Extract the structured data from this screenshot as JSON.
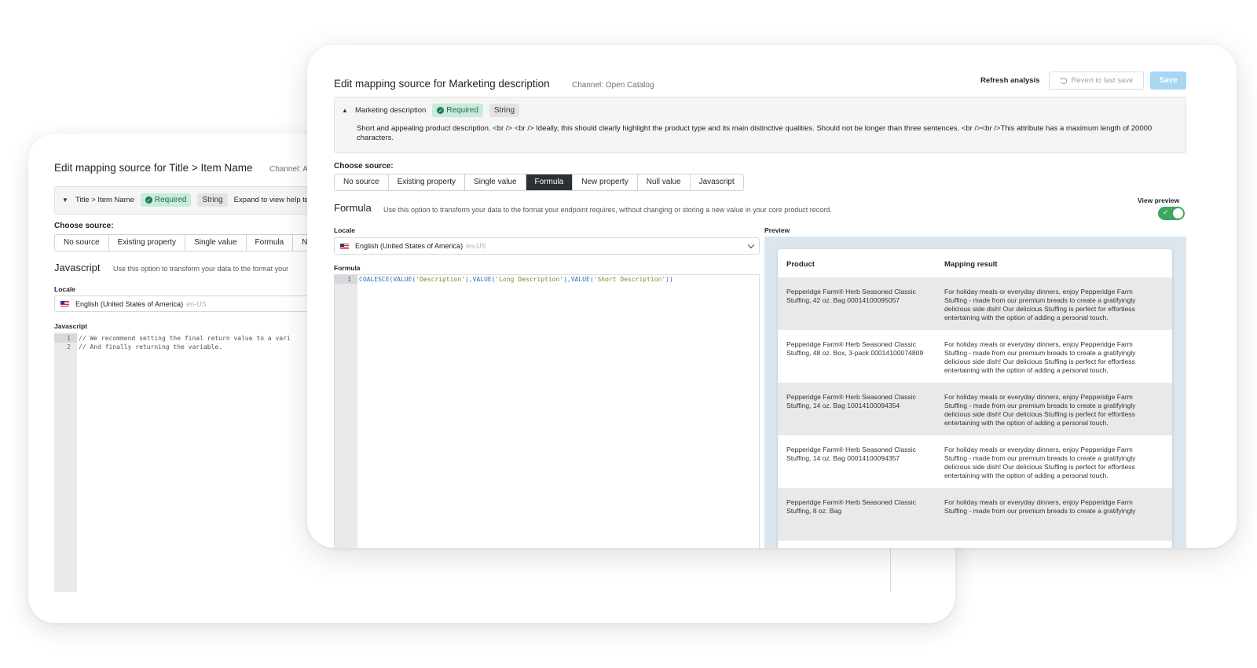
{
  "back": {
    "title": "Edit mapping source for Title > Item Name",
    "channel": "Channel: A",
    "attribute": {
      "name": "Title > Item Name",
      "required": "Required",
      "type": "String",
      "expand_help": "Expand to view help text"
    },
    "choose_source": "Choose source:",
    "tabs": [
      "No source",
      "Existing property",
      "Single value",
      "Formula",
      "N"
    ],
    "section_title": "Javascript",
    "section_desc": "Use this option to transform your data to the format your",
    "locale_label": "Locale",
    "locale_value": "English (United States of America)",
    "locale_code": "en-US",
    "editor_label": "Javascript",
    "code_lines": [
      {
        "n": "1",
        "text": "// We recommend setting the final return value to a vari"
      },
      {
        "n": "2",
        "text": "// And finally returning the variable."
      }
    ]
  },
  "front": {
    "title": "Edit mapping source for Marketing description",
    "channel": "Channel: Open Catalog",
    "refresh": "Refresh analysis",
    "revert": "Revert to last save",
    "save": "Save",
    "attribute": {
      "name": "Marketing description",
      "required": "Required",
      "type": "String",
      "help_text": "Short and appealing product description. <br /> <br /> Ideally, this should clearly highlight the product type and its main distinctive qualities. Should not be longer than three sentences. <br /><br />This attribute has a maximum length of 20000 characters."
    },
    "choose_source": "Choose source:",
    "tabs": [
      "No source",
      "Existing property",
      "Single value",
      "Formula",
      "New property",
      "Null value",
      "Javascript"
    ],
    "active_tab": "Formula",
    "section_title": "Formula",
    "section_desc": "Use this option to transform your data to the format your endpoint requires, without changing or storing a new value in your core product record.",
    "view_preview": "View preview",
    "view_preview_on": true,
    "locale_label": "Locale",
    "locale_value": "English (United States of America)",
    "locale_code": "en-US",
    "formula_label": "Formula",
    "formula_line_number": "1",
    "formula_parts": {
      "p1": "COALESCE(VALUE(",
      "s1": "'Description'",
      "p2": "),VALUE(",
      "s2": "'Long Description'",
      "p3": "),VALUE(",
      "s3": "'Short Description'",
      "p4": "))"
    },
    "preview_label": "Preview",
    "preview": {
      "col_product": "Product",
      "col_result": "Mapping result",
      "rows": [
        {
          "product": "Pepperidge Farm® Herb Seasoned Classic Stuffing, 42 oz. Bag 00014100095057",
          "result": "For holiday meals or everyday dinners, enjoy Pepperidge Farm Stuffing - made from our premium breads to create a gratifyingly delicious side dish! Our delicious Stuffing is perfect for effortless entertaining with the option of adding a personal touch."
        },
        {
          "product": "Pepperidge Farm® Herb Seasoned Classic Stuffing, 48 oz. Box, 3-pack 00014100074809",
          "result": "For holiday meals or everyday dinners, enjoy Pepperidge Farm Stuffing - made from our premium breads to create a gratifyingly delicious side dish! Our delicious Stuffing is perfect for effortless entertaining with the option of adding a personal touch."
        },
        {
          "product": "Pepperidge Farm® Herb Seasoned Classic Stuffing, 14 oz. Bag 10014100094354",
          "result": "For holiday meals or everyday dinners, enjoy Pepperidge Farm Stuffing - made from our premium breads to create a gratifyingly delicious side dish! Our delicious Stuffing is perfect for effortless entertaining with the option of adding a personal touch."
        },
        {
          "product": "Pepperidge Farm® Herb Seasoned Classic Stuffing, 14 oz. Bag 00014100094357",
          "result": "For holiday meals or everyday dinners, enjoy Pepperidge Farm Stuffing - made from our premium breads to create a gratifyingly delicious side dish! Our delicious Stuffing is perfect for effortless entertaining with the option of adding a personal touch."
        },
        {
          "product": "Pepperidge Farm® Herb Seasoned Classic Stuffing, 8 oz. Bag",
          "result": "For holiday meals or everyday dinners, enjoy Pepperidge Farm Stuffing - made from our premium breads to create a gratifyingly"
        }
      ]
    }
  }
}
